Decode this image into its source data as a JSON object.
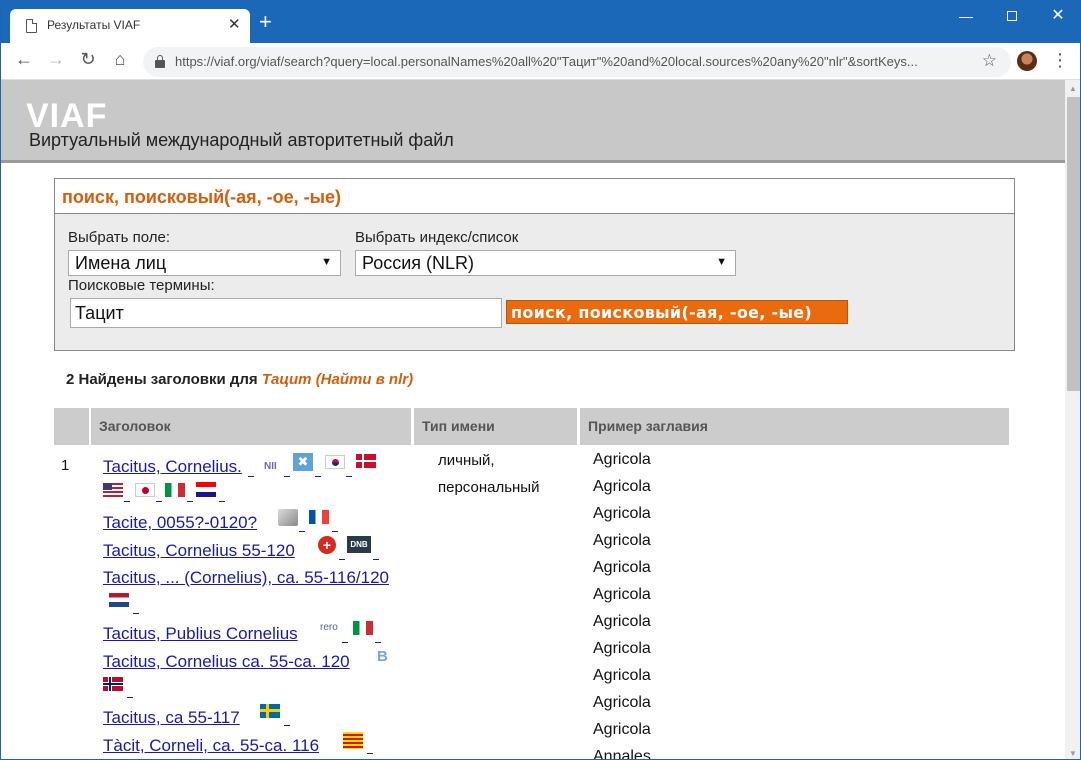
{
  "browser": {
    "tab_title": "Результаты VIAF",
    "tab_close": "✕",
    "new_tab": "+",
    "url": "https://viaf.org/viaf/search?query=local.personalNames%20all%20\"Тацит\"%20and%20local.sources%20any%20\"nlr\"&sortKeys..."
  },
  "header": {
    "logo": "VIAF",
    "subtitle": "Виртуальный международный авторитетный файл"
  },
  "search": {
    "title": "поиск, поисковый(-ая, -ое, -ые)",
    "field_label": "Выбрать поле:",
    "field_value": "Имена лиц",
    "index_label": "Выбрать индекс/список",
    "index_value": "Россия (NLR)",
    "terms_label": "Поисковые термины:",
    "terms_value": "Тацит",
    "button_label": "поиск, поисковый(-ая, -ое, -ые)"
  },
  "results": {
    "count_prefix": "2 Найдены заголовки для ",
    "query_text": "Тацит (Найти в  nlr)",
    "columns": {
      "num": "",
      "heading": "Заголовок",
      "name_type": "Тип имени",
      "sample_title": "Пример заглавия"
    },
    "row1": {
      "num": "1",
      "name_type_1": "личный,",
      "name_type_2": "персональный",
      "headings": [
        "Tacitus, Cornelius. ",
        "Tacite, 0055?-0120? ",
        "Tacitus, Cornelius 55-120 ",
        "Tacitus, ... (Cornelius), ca. 55-116/120 ",
        "Tacitus, Publius Cornelius ",
        "Tacitus, Cornelius ca. 55-ca. 120 ",
        "Tacitus, ca 55-117 ",
        "Tàcit, Corneli, ca. 55-ca. 116 "
      ],
      "samples": [
        "Agricola",
        "Agricola",
        "Agricola",
        "Agricola",
        "Agricola",
        "Agricola",
        "Agricola",
        "Agricola",
        "Agricola",
        "Agricola",
        "Agricola",
        "Annales"
      ]
    },
    "source_marks": {
      "nii": "NII",
      "dnb": "DNB",
      "rero": "rero",
      "b": "B"
    }
  }
}
